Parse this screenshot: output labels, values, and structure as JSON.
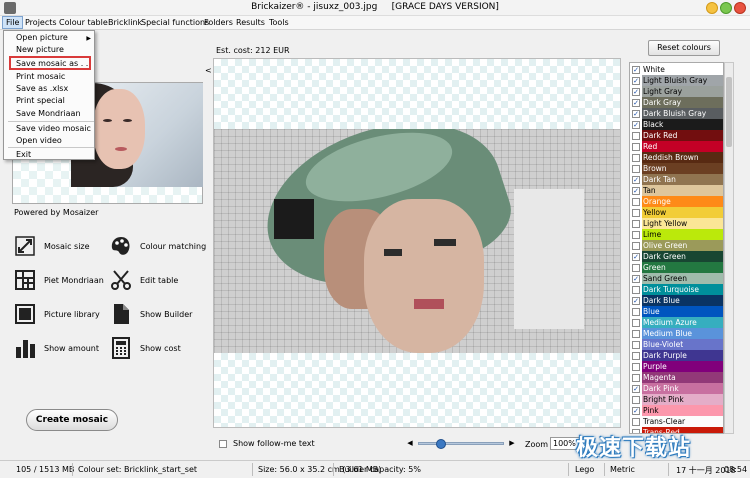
{
  "window": {
    "title": "Brickaizer® - jisuxz_003.jpg",
    "edition": "[GRACE DAYS VERSION]"
  },
  "menubar": {
    "items": [
      "File",
      "Projects",
      "Colour table",
      "Bricklink",
      "Special functions",
      "Folders",
      "Results",
      "Tools"
    ]
  },
  "file_menu": {
    "items": [
      "Open picture",
      "New picture",
      "Save mosaic as . .",
      "Print mosaic",
      "Save as .xlsx",
      "Print special",
      "Save Mondriaan",
      "Save video mosaic",
      "Open video",
      "Exit"
    ],
    "highlighted": "Save mosaic as . ."
  },
  "left_panel": {
    "powered_by": "Powered by Mosaizer",
    "tools": [
      {
        "label": "Mosaic size",
        "icon": "mosaic-size-icon"
      },
      {
        "label": "Colour matching",
        "icon": "palette-icon"
      },
      {
        "label": "Piet Mondriaan",
        "icon": "grid-icon"
      },
      {
        "label": "Edit table",
        "icon": "scissors-icon"
      },
      {
        "label": "Picture library",
        "icon": "picture-library-icon"
      },
      {
        "label": "Show Builder",
        "icon": "document-icon"
      },
      {
        "label": "Show amount",
        "icon": "bar-chart-icon"
      },
      {
        "label": "Show cost",
        "icon": "calculator-icon"
      }
    ],
    "create_button": "Create mosaic"
  },
  "canvas": {
    "est_cost": "Est. cost: 212 EUR",
    "collapse_arrow": "<",
    "follow_me_label": "Show follow-me text",
    "follow_me_checked": false,
    "zoom_label": "Zoom",
    "zoom_value": "100%"
  },
  "colour_panel": {
    "reset_button": "Reset colours",
    "colors": [
      {
        "name": "White",
        "checked": true,
        "hex": "#ffffff",
        "text": "#000000"
      },
      {
        "name": "Light Bluish Gray",
        "checked": true,
        "hex": "#a0a5a9",
        "text": "#000000"
      },
      {
        "name": "Light Gray",
        "checked": true,
        "hex": "#9ba19d",
        "text": "#000000"
      },
      {
        "name": "Dark Gray",
        "checked": true,
        "hex": "#6d6e5c",
        "text": "#ffffff"
      },
      {
        "name": "Dark Bluish Gray",
        "checked": true,
        "hex": "#595d60",
        "text": "#ffffff"
      },
      {
        "name": "Black",
        "checked": true,
        "hex": "#1b1b1b",
        "text": "#ffffff"
      },
      {
        "name": "Dark Red",
        "checked": false,
        "hex": "#720e0f",
        "text": "#ffffff"
      },
      {
        "name": "Red",
        "checked": false,
        "hex": "#c40026",
        "text": "#ffffff"
      },
      {
        "name": "Reddish Brown",
        "checked": false,
        "hex": "#582a12",
        "text": "#ffffff"
      },
      {
        "name": "Brown",
        "checked": false,
        "hex": "#6b3f22",
        "text": "#ffffff"
      },
      {
        "name": "Dark Tan",
        "checked": true,
        "hex": "#907450",
        "text": "#ffffff"
      },
      {
        "name": "Tan",
        "checked": true,
        "hex": "#dec69c",
        "text": "#000000"
      },
      {
        "name": "Orange",
        "checked": false,
        "hex": "#fe8a18",
        "text": "#ffffff"
      },
      {
        "name": "Yellow",
        "checked": false,
        "hex": "#f2cd37",
        "text": "#000000"
      },
      {
        "name": "Light Yellow",
        "checked": false,
        "hex": "#fbe696",
        "text": "#000000"
      },
      {
        "name": "Lime",
        "checked": false,
        "hex": "#bbe90b",
        "text": "#000000"
      },
      {
        "name": "Olive Green",
        "checked": false,
        "hex": "#9b9a5a",
        "text": "#ffffff"
      },
      {
        "name": "Dark Green",
        "checked": true,
        "hex": "#184632",
        "text": "#ffffff"
      },
      {
        "name": "Green",
        "checked": false,
        "hex": "#237841",
        "text": "#ffffff"
      },
      {
        "name": "Sand Green",
        "checked": true,
        "hex": "#a0bcac",
        "text": "#000000"
      },
      {
        "name": "Dark Turquoise",
        "checked": false,
        "hex": "#008f9b",
        "text": "#ffffff"
      },
      {
        "name": "Dark Blue",
        "checked": true,
        "hex": "#0a3463",
        "text": "#ffffff"
      },
      {
        "name": "Blue",
        "checked": false,
        "hex": "#0055bf",
        "text": "#ffffff"
      },
      {
        "name": "Medium Azure",
        "checked": false,
        "hex": "#36aebf",
        "text": "#ffffff"
      },
      {
        "name": "Medium Blue",
        "checked": false,
        "hex": "#5a93db",
        "text": "#ffffff"
      },
      {
        "name": "Blue-Violet",
        "checked": false,
        "hex": "#6874ca",
        "text": "#ffffff"
      },
      {
        "name": "Dark Purple",
        "checked": false,
        "hex": "#3f3691",
        "text": "#ffffff"
      },
      {
        "name": "Purple",
        "checked": false,
        "hex": "#81007b",
        "text": "#ffffff"
      },
      {
        "name": "Magenta",
        "checked": false,
        "hex": "#923978",
        "text": "#ffffff"
      },
      {
        "name": "Dark Pink",
        "checked": true,
        "hex": "#c870a0",
        "text": "#ffffff"
      },
      {
        "name": "Bright Pink",
        "checked": false,
        "hex": "#e4adc8",
        "text": "#000000"
      },
      {
        "name": "Pink",
        "checked": true,
        "hex": "#fc97ac",
        "text": "#000000"
      },
      {
        "name": "Trans-Clear",
        "checked": false,
        "hex": "#fcfcfc",
        "text": "#000000"
      },
      {
        "name": "Trans-Red",
        "checked": false,
        "hex": "#c91a09",
        "text": "#ffffff"
      }
    ]
  },
  "statusbar": {
    "memory": "105 / 1513 MB",
    "colour_set": "Colour set: Bricklink_start_set",
    "size": "Size: 56.0 x 35.2 cm (3.61 MB)",
    "builder_capacity": "Builder capacity: 5%",
    "brand": "Lego",
    "units": "Metric",
    "date": "17 十一月 2018",
    "time": "08:54"
  },
  "watermark": "极速下载站"
}
